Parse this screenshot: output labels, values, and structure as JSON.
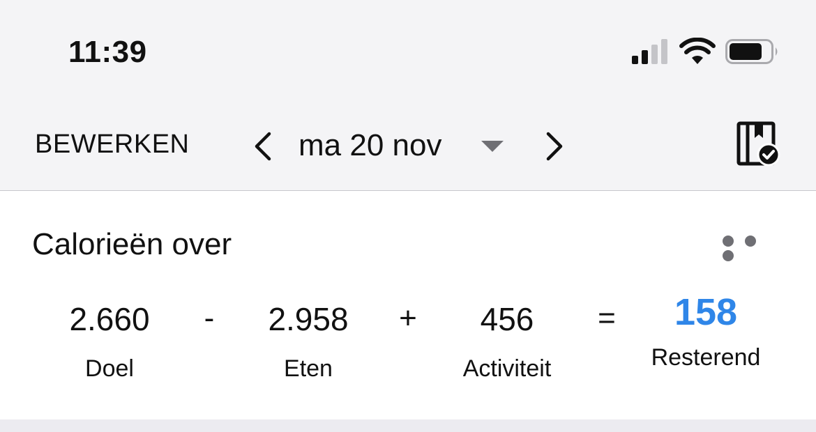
{
  "status_bar": {
    "time": "11:39",
    "icons": [
      "signal-icon",
      "wifi-icon",
      "battery-icon"
    ]
  },
  "nav": {
    "edit_label": "BEWERKEN",
    "date_label": "ma 20 nov",
    "icons": [
      "chevron-left-icon",
      "caret-down-icon",
      "chevron-right-icon",
      "diary-complete-icon"
    ]
  },
  "calories": {
    "title": "Calorieën over",
    "goal": {
      "value": "2.660",
      "label": "Doel"
    },
    "minus": "-",
    "food": {
      "value": "2.958",
      "label": "Eten"
    },
    "plus": "+",
    "activity": {
      "value": "456",
      "label": "Activiteit"
    },
    "equals": "=",
    "remaining": {
      "value": "158",
      "label": "Resterend"
    },
    "remaining_color": "#2f86e8"
  }
}
